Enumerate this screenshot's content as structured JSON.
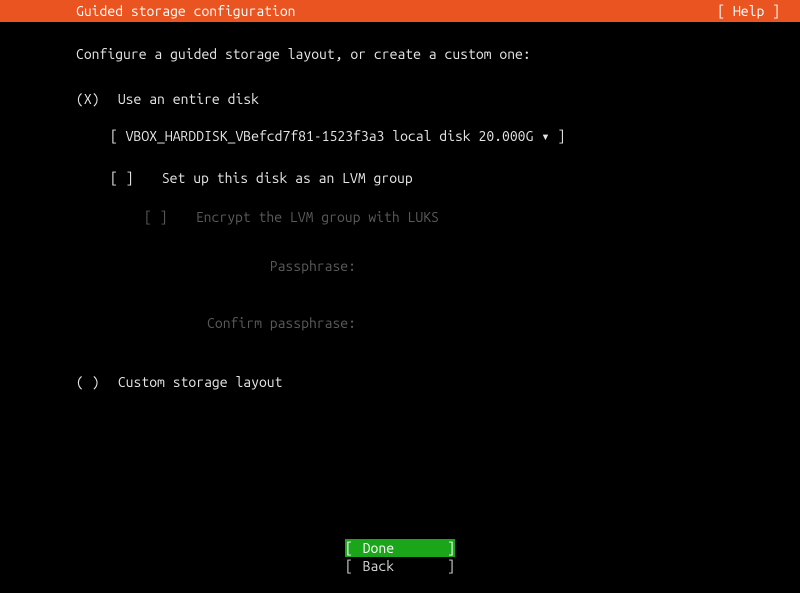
{
  "titlebar": {
    "title": "Guided storage configuration",
    "help": "[ Help ]"
  },
  "instruction": "Configure a guided storage layout, or create a custom one:",
  "options": {
    "entire_disk": {
      "mark": "(X)",
      "label": "Use an entire disk",
      "disk_selector": "[ VBOX_HARDDISK_VBefcd7f81-1523f3a3 local disk 20.000G ▾ ]",
      "lvm": {
        "mark": "[ ]",
        "label": "Set up this disk as an LVM group",
        "encrypt": {
          "mark": "[ ]",
          "label": "Encrypt the LVM group with LUKS",
          "passphrase_label": "Passphrase:",
          "confirm_label": "Confirm passphrase:"
        }
      }
    },
    "custom": {
      "mark": "( )",
      "label": "Custom storage layout"
    }
  },
  "buttons": {
    "done": "Done",
    "back": "Back"
  }
}
